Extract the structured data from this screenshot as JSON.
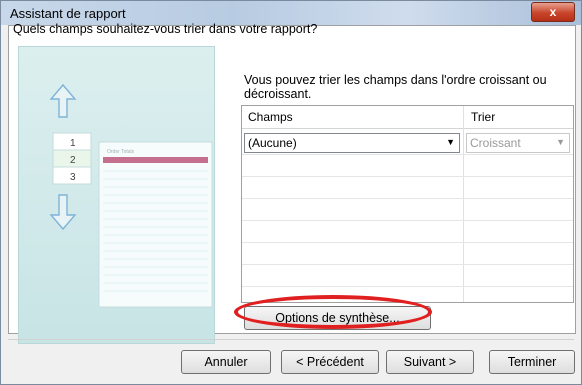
{
  "window": {
    "title": "Assistant de rapport",
    "close_symbol": "x"
  },
  "question": "Quels champs souhaitez-vous trier dans votre rapport?",
  "hint": "Vous pouvez trier les champs dans l'ordre croissant ou décroissant.",
  "illustration": {
    "numbers": [
      "1",
      "2",
      "3"
    ],
    "table_title": "Order Totals"
  },
  "grid": {
    "col_champs": "Champs",
    "col_trier": "Trier",
    "field_value": "(Aucune)",
    "sort_value": "Croissant"
  },
  "buttons": {
    "options": "Options de synthèse...",
    "cancel": "Annuler",
    "back": "< Précédent",
    "next": "Suivant >",
    "finish": "Terminer"
  },
  "colors": {
    "highlight_oval": "#e02020",
    "illustration_bg": "#cde6e7"
  }
}
